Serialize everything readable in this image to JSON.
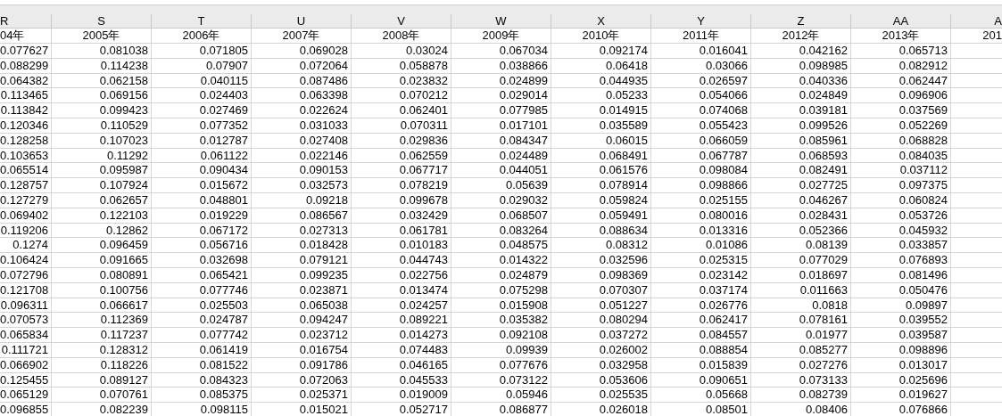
{
  "columns": [
    {
      "letter": "R",
      "header": "04年"
    },
    {
      "letter": "S",
      "header": "2005年"
    },
    {
      "letter": "T",
      "header": "2006年"
    },
    {
      "letter": "U",
      "header": "2007年"
    },
    {
      "letter": "V",
      "header": "2008年"
    },
    {
      "letter": "W",
      "header": "2009年"
    },
    {
      "letter": "X",
      "header": "2010年"
    },
    {
      "letter": "Y",
      "header": "2011年"
    },
    {
      "letter": "Z",
      "header": "2012年"
    },
    {
      "letter": "AA",
      "header": "2013年"
    },
    {
      "letter": "A",
      "header": "201"
    }
  ],
  "rows": [
    [
      "0.077627",
      "0.081038",
      "0.071805",
      "0.069028",
      "0.03024",
      "0.067034",
      "0.092174",
      "0.016041",
      "0.042162",
      "0.065713"
    ],
    [
      "0.088299",
      "0.114238",
      "0.07907",
      "0.072064",
      "0.058878",
      "0.038866",
      "0.06418",
      "0.03066",
      "0.098985",
      "0.082912"
    ],
    [
      "0.064382",
      "0.062158",
      "0.040115",
      "0.087486",
      "0.023832",
      "0.024899",
      "0.044935",
      "0.026597",
      "0.040336",
      "0.062447"
    ],
    [
      "0.113465",
      "0.069156",
      "0.024403",
      "0.063398",
      "0.070212",
      "0.029014",
      "0.05233",
      "0.054066",
      "0.024849",
      "0.096906"
    ],
    [
      "0.113842",
      "0.099423",
      "0.027469",
      "0.022624",
      "0.062401",
      "0.077985",
      "0.014915",
      "0.074068",
      "0.039181",
      "0.037569"
    ],
    [
      "0.120346",
      "0.110529",
      "0.077352",
      "0.031033",
      "0.070311",
      "0.017101",
      "0.035589",
      "0.055423",
      "0.099526",
      "0.052269"
    ],
    [
      "0.128258",
      "0.107023",
      "0.012787",
      "0.027408",
      "0.029836",
      "0.084347",
      "0.06015",
      "0.066059",
      "0.085961",
      "0.068828"
    ],
    [
      "0.103653",
      "0.11292",
      "0.061122",
      "0.022146",
      "0.062559",
      "0.024489",
      "0.068491",
      "0.067787",
      "0.068593",
      "0.084035"
    ],
    [
      "0.065514",
      "0.095987",
      "0.090434",
      "0.090153",
      "0.067717",
      "0.044051",
      "0.061576",
      "0.098084",
      "0.082491",
      "0.037112"
    ],
    [
      "0.128757",
      "0.107924",
      "0.015672",
      "0.032573",
      "0.078219",
      "0.05639",
      "0.078914",
      "0.098866",
      "0.027725",
      "0.097375"
    ],
    [
      "0.127279",
      "0.062657",
      "0.048801",
      "0.09218",
      "0.099678",
      "0.029032",
      "0.059824",
      "0.025155",
      "0.046267",
      "0.060824"
    ],
    [
      "0.069402",
      "0.122103",
      "0.019229",
      "0.086567",
      "0.032429",
      "0.068507",
      "0.059491",
      "0.080016",
      "0.028431",
      "0.053726"
    ],
    [
      "0.119206",
      "0.12862",
      "0.067172",
      "0.027313",
      "0.061781",
      "0.083264",
      "0.088634",
      "0.013316",
      "0.052366",
      "0.045932"
    ],
    [
      "0.1274",
      "0.096459",
      "0.056716",
      "0.018428",
      "0.010183",
      "0.048575",
      "0.08312",
      "0.01086",
      "0.08139",
      "0.033857"
    ],
    [
      "0.106424",
      "0.091665",
      "0.032698",
      "0.079121",
      "0.044743",
      "0.014322",
      "0.032596",
      "0.025315",
      "0.077029",
      "0.076893"
    ],
    [
      "0.072796",
      "0.080891",
      "0.065421",
      "0.099235",
      "0.022756",
      "0.024879",
      "0.098369",
      "0.023142",
      "0.018697",
      "0.081496"
    ],
    [
      "0.121708",
      "0.100756",
      "0.077746",
      "0.023871",
      "0.013474",
      "0.075298",
      "0.070307",
      "0.037174",
      "0.011663",
      "0.050476"
    ],
    [
      "0.096311",
      "0.066617",
      "0.025503",
      "0.065038",
      "0.024257",
      "0.015908",
      "0.051227",
      "0.026776",
      "0.0818",
      "0.09897"
    ],
    [
      "0.070573",
      "0.112369",
      "0.024787",
      "0.094247",
      "0.089221",
      "0.035382",
      "0.080294",
      "0.062417",
      "0.078161",
      "0.039552"
    ],
    [
      "0.065834",
      "0.117237",
      "0.077742",
      "0.023712",
      "0.014273",
      "0.092108",
      "0.037272",
      "0.084557",
      "0.01977",
      "0.039587"
    ],
    [
      "0.111721",
      "0.128312",
      "0.061419",
      "0.016754",
      "0.074483",
      "0.09939",
      "0.026002",
      "0.088854",
      "0.085277",
      "0.098896"
    ],
    [
      "0.066902",
      "0.118226",
      "0.081522",
      "0.091786",
      "0.046165",
      "0.077676",
      "0.032958",
      "0.015839",
      "0.027276",
      "0.013017"
    ],
    [
      "0.125455",
      "0.089127",
      "0.084323",
      "0.072063",
      "0.045533",
      "0.073122",
      "0.053606",
      "0.090651",
      "0.073133",
      "0.025696"
    ],
    [
      "0.065129",
      "0.070761",
      "0.085375",
      "0.025371",
      "0.019009",
      "0.05946",
      "0.025535",
      "0.05668",
      "0.082739",
      "0.019627"
    ],
    [
      "0.096855",
      "0.082239",
      "0.098115",
      "0.015021",
      "0.052717",
      "0.086877",
      "0.026018",
      "0.08501",
      "0.08406",
      "0.076866"
    ]
  ]
}
